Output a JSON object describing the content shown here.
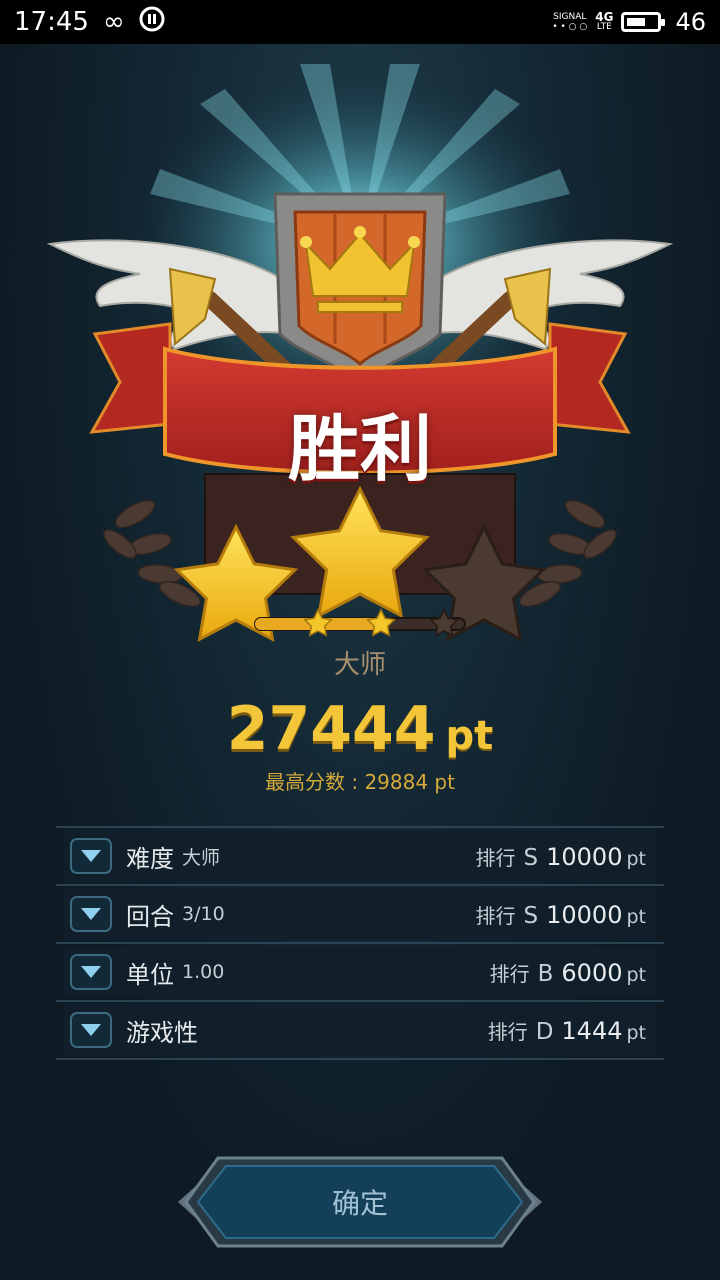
{
  "status_bar": {
    "time": "17:45",
    "signal_label": "SIGNAL",
    "network": "4G",
    "network_sub": "LTE",
    "battery_level": "46"
  },
  "result": {
    "title": "胜利",
    "stars_earned": 2,
    "stars_total": 3,
    "rank_label": "大师",
    "score": "27444",
    "score_unit": "pt",
    "best_score": "最高分数 : 29884 pt"
  },
  "stats": [
    {
      "name": "难度",
      "value": "大师",
      "rank_label": "排行",
      "grade": "S",
      "points": "10000",
      "unit": "pt"
    },
    {
      "name": "回合",
      "value": "3/10",
      "rank_label": "排行",
      "grade": "S",
      "points": "10000",
      "unit": "pt"
    },
    {
      "name": "单位",
      "value": "1.00",
      "rank_label": "排行",
      "grade": "B",
      "points": "6000",
      "unit": "pt"
    },
    {
      "name": "游戏性",
      "value": "",
      "rank_label": "排行",
      "grade": "D",
      "points": "1444",
      "unit": "pt"
    }
  ],
  "confirm_button": "确定",
  "colors": {
    "background": "#0e1b24",
    "gold": "#f3c538",
    "ribbon_red": "#c0302a",
    "shield_orange": "#d4682a",
    "button_teal": "#143f58"
  }
}
